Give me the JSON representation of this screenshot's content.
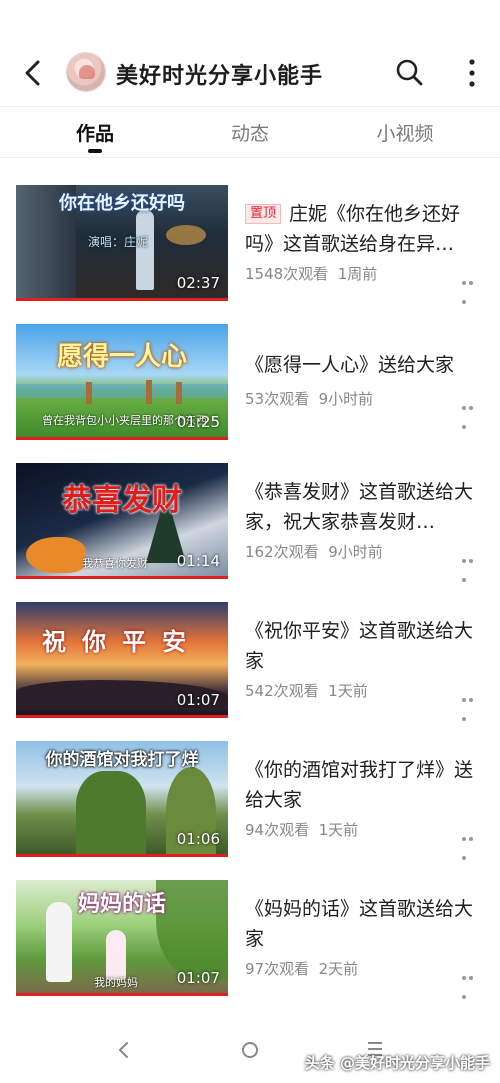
{
  "header": {
    "title": "美好时光分享小能手",
    "icons": {
      "back": "back-arrow-icon",
      "search": "search-icon",
      "more": "more-vertical-icon"
    }
  },
  "tabs": [
    {
      "label": "作品",
      "active": true
    },
    {
      "label": "动态",
      "active": false
    },
    {
      "label": "小视频",
      "active": false
    }
  ],
  "videos": [
    {
      "pinned": true,
      "pin_label": "置顶",
      "title": "庄妮《你在他乡还好吗》这首歌送给身在异…",
      "views": "1548次观看",
      "time": "1周前",
      "duration": "02:37",
      "thumb_title": "你在他乡还好吗",
      "thumb_sub": "演唱：庄妮"
    },
    {
      "pinned": false,
      "title": "《愿得一人心》送给大家",
      "views": "53次观看",
      "time": "9小时前",
      "duration": "01:25",
      "thumb_title": "愿得一人心",
      "thumb_sub": "曾在我背包小小夹层里的那个东西"
    },
    {
      "pinned": false,
      "title": "《恭喜发财》这首歌送给大家，祝大家恭喜发财…",
      "views": "162次观看",
      "time": "9小时前",
      "duration": "01:14",
      "thumb_title": "恭喜发财",
      "thumb_sub": "我恭喜你发财"
    },
    {
      "pinned": false,
      "title": "《祝你平安》这首歌送给大家",
      "views": "542次观看",
      "time": "1天前",
      "duration": "01:07",
      "thumb_title": "祝你平安",
      "thumb_sub": ""
    },
    {
      "pinned": false,
      "title": "《你的酒馆对我打了烊》送给大家",
      "views": "94次观看",
      "time": "1天前",
      "duration": "01:06",
      "thumb_title": "你的酒馆对我打了烊",
      "thumb_sub": ""
    },
    {
      "pinned": false,
      "title": "《妈妈的话》这首歌送给大家",
      "views": "97次观看",
      "time": "2天前",
      "duration": "01:07",
      "thumb_title": "妈妈的话",
      "thumb_sub": "我的妈妈"
    }
  ],
  "watermark": "头条 @美好时光分享小能手",
  "navbar": {
    "icons": [
      "nav-back-icon",
      "nav-home-icon",
      "nav-menu-icon"
    ]
  }
}
